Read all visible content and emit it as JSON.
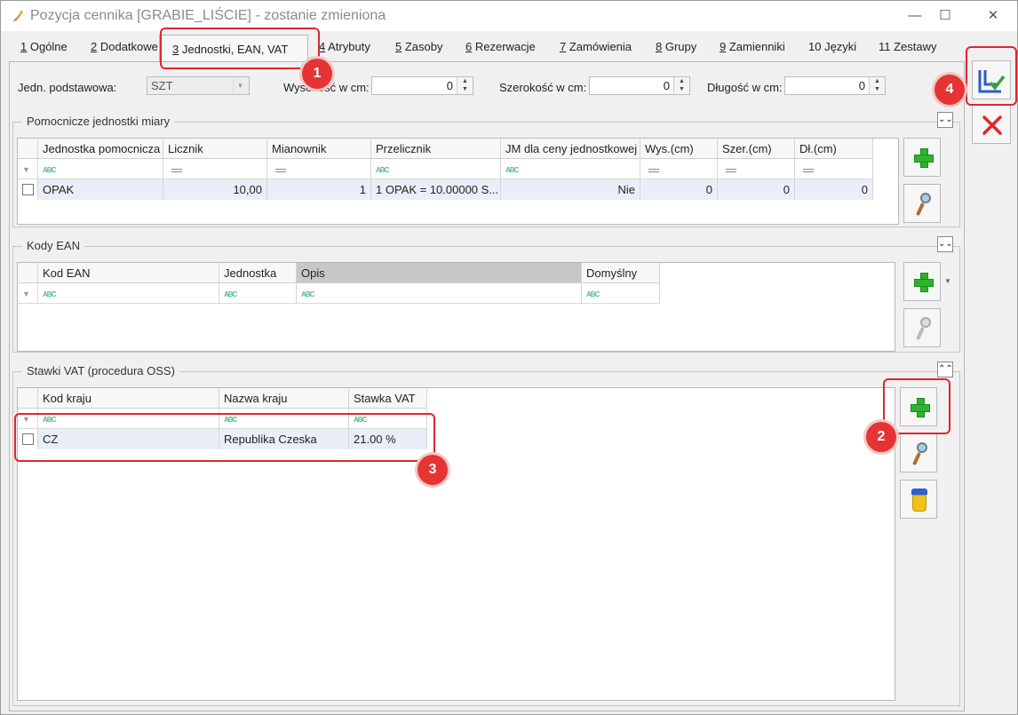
{
  "window": {
    "title": "Pozycja cennika [GRABIE_LIŚCIE] - zostanie zmieniona",
    "minimize_glyph": "—",
    "maximize_glyph": "☐",
    "close_glyph": "✕"
  },
  "tabs": [
    {
      "num": "1",
      "label": " Ogólne"
    },
    {
      "num": "2",
      "label": " Dodatkowe"
    },
    {
      "num": "3",
      "label": " Jednostki, EAN, VAT"
    },
    {
      "num": "4",
      "label": " Atrybuty"
    },
    {
      "num": "5",
      "label": " Zasoby"
    },
    {
      "num": "6",
      "label": " Rezerwacje"
    },
    {
      "num": "7",
      "label": " Zamówienia"
    },
    {
      "num": "8",
      "label": " Grupy"
    },
    {
      "num": "9",
      "label": " Zamienniki"
    },
    {
      "num": "10",
      "label": " Języki"
    },
    {
      "num": "11",
      "label": " Zestawy"
    }
  ],
  "fields": {
    "base_unit_label": "Jedn. podstawowa:",
    "base_unit_value": "SZT",
    "height_label": "Wysokość w cm:",
    "height_value": "0",
    "width_label": "Szerokość w cm:",
    "width_value": "0",
    "length_label": "Długość w cm:",
    "length_value": "0"
  },
  "aux_units": {
    "title": "Pomocnicze jednostki miary",
    "columns": [
      "Jednostka pomocnicza",
      "Licznik",
      "Mianownik",
      "Przelicznik",
      "JM dla ceny jednostkowej",
      "Wys.(cm)",
      "Szer.(cm)",
      "Dł.(cm)"
    ],
    "rows": [
      {
        "unit": "OPAK",
        "numerator": "10,00",
        "denominator": "1",
        "conversion": "1 OPAK = 10.00000 S...",
        "unit_price_jm": "Nie",
        "height": "0",
        "width": "0",
        "length": "0"
      }
    ]
  },
  "ean": {
    "title": "Kody EAN",
    "columns": [
      "Kod EAN",
      "Jednostka",
      "Opis",
      "Domyślny"
    ]
  },
  "vat": {
    "title": "Stawki VAT (procedura OSS)",
    "columns": [
      "Kod kraju",
      "Nazwa kraju",
      "Stawka VAT"
    ],
    "rows": [
      {
        "code": "CZ",
        "name": "Republika Czeska",
        "rate": "21.00 %"
      }
    ]
  },
  "badges": {
    "b1": "1",
    "b2": "2",
    "b3": "3",
    "b4": "4"
  },
  "glyphs": {
    "collapse_down": "⌄⌄",
    "collapse_up": "⌃⌃",
    "dropdown": "▼",
    "spin_up": "▲",
    "spin_down": "▼",
    "funnel": "▼"
  },
  "colors": {
    "highlight_red": "#e0262c",
    "plus_green": "#2fb32f",
    "row_highlight": "#e9eef8"
  }
}
